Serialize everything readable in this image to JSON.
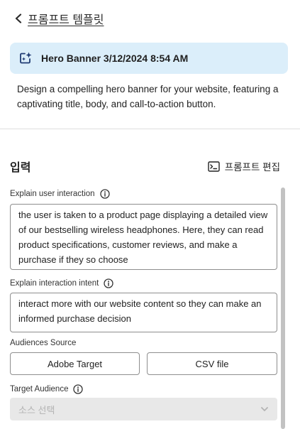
{
  "header": {
    "back_label": "프롬프트 템플릿"
  },
  "banner": {
    "title": "Hero Banner 3/12/2024 8:54 AM"
  },
  "description": "Design a compelling hero banner for your website, featuring a captivating title, body, and call-to-action button.",
  "input_section": {
    "title": "입력",
    "edit_prompt_label": "프롬프트 편집"
  },
  "fields": {
    "user_interaction": {
      "label": "Explain user interaction",
      "value": "the user is taken to a product page displaying a detailed view of our bestselling wireless headphones. Here, they can read product specifications, customer reviews, and make a purchase if they so choose"
    },
    "interaction_intent": {
      "label": "Explain interaction intent",
      "value": "interact more with our website content so they can make an informed purchase decision"
    },
    "audiences_source": {
      "label": "Audiences Source",
      "options": [
        "Adobe Target",
        "CSV file"
      ]
    },
    "target_audience": {
      "label": "Target Audience",
      "placeholder": "소스 선택"
    }
  },
  "colors": {
    "banner_bg": "#dbeefa",
    "select_disabled_bg": "#e8e8e8",
    "border": "#8e8e8e"
  },
  "icons": {
    "back": "chevron-left-icon",
    "banner": "sparkle-template-icon",
    "edit_prompt": "prompt-terminal-icon",
    "info": "info-icon",
    "select": "chevron-down-icon"
  }
}
